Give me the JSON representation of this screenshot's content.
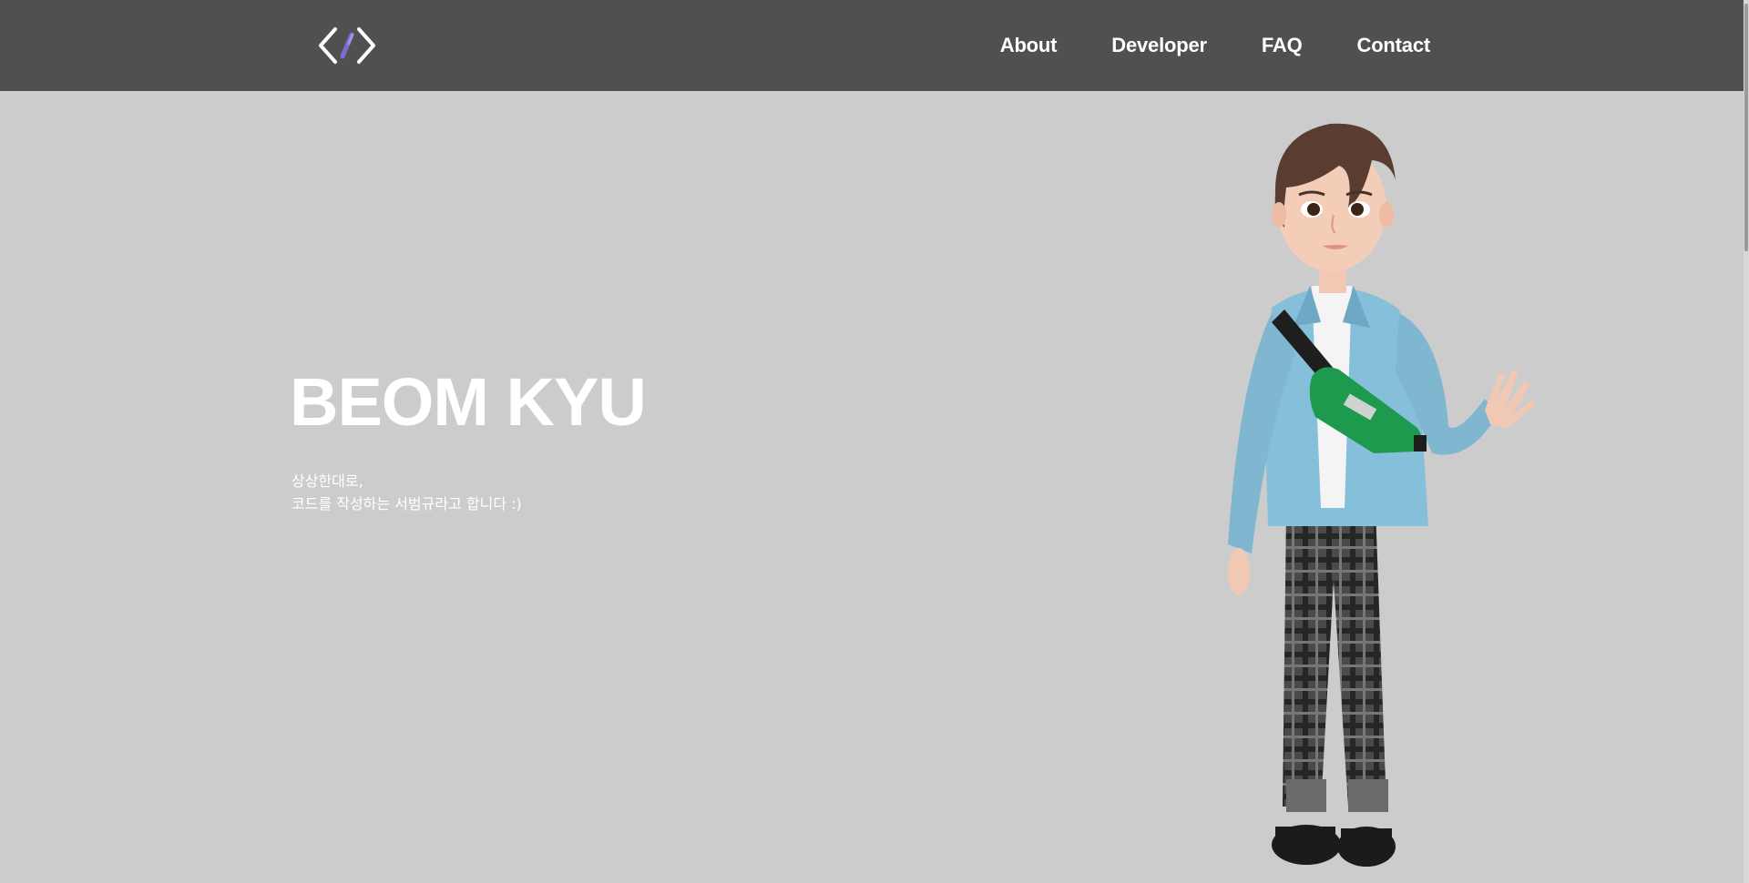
{
  "header": {
    "logo_icon": "code-brackets-icon",
    "nav": [
      {
        "label": "About"
      },
      {
        "label": "Developer"
      },
      {
        "label": "FAQ"
      },
      {
        "label": "Contact"
      }
    ]
  },
  "hero": {
    "title": "BEOM KYU",
    "subtitle_line1": "상상한대로,",
    "subtitle_line2": "코드를 작성하는 서범규라고 합니다 :)"
  },
  "colors": {
    "header_bg": "#505050",
    "page_bg": "#cccccc",
    "text": "#ffffff",
    "logo_accent": "#7b6bd6"
  }
}
